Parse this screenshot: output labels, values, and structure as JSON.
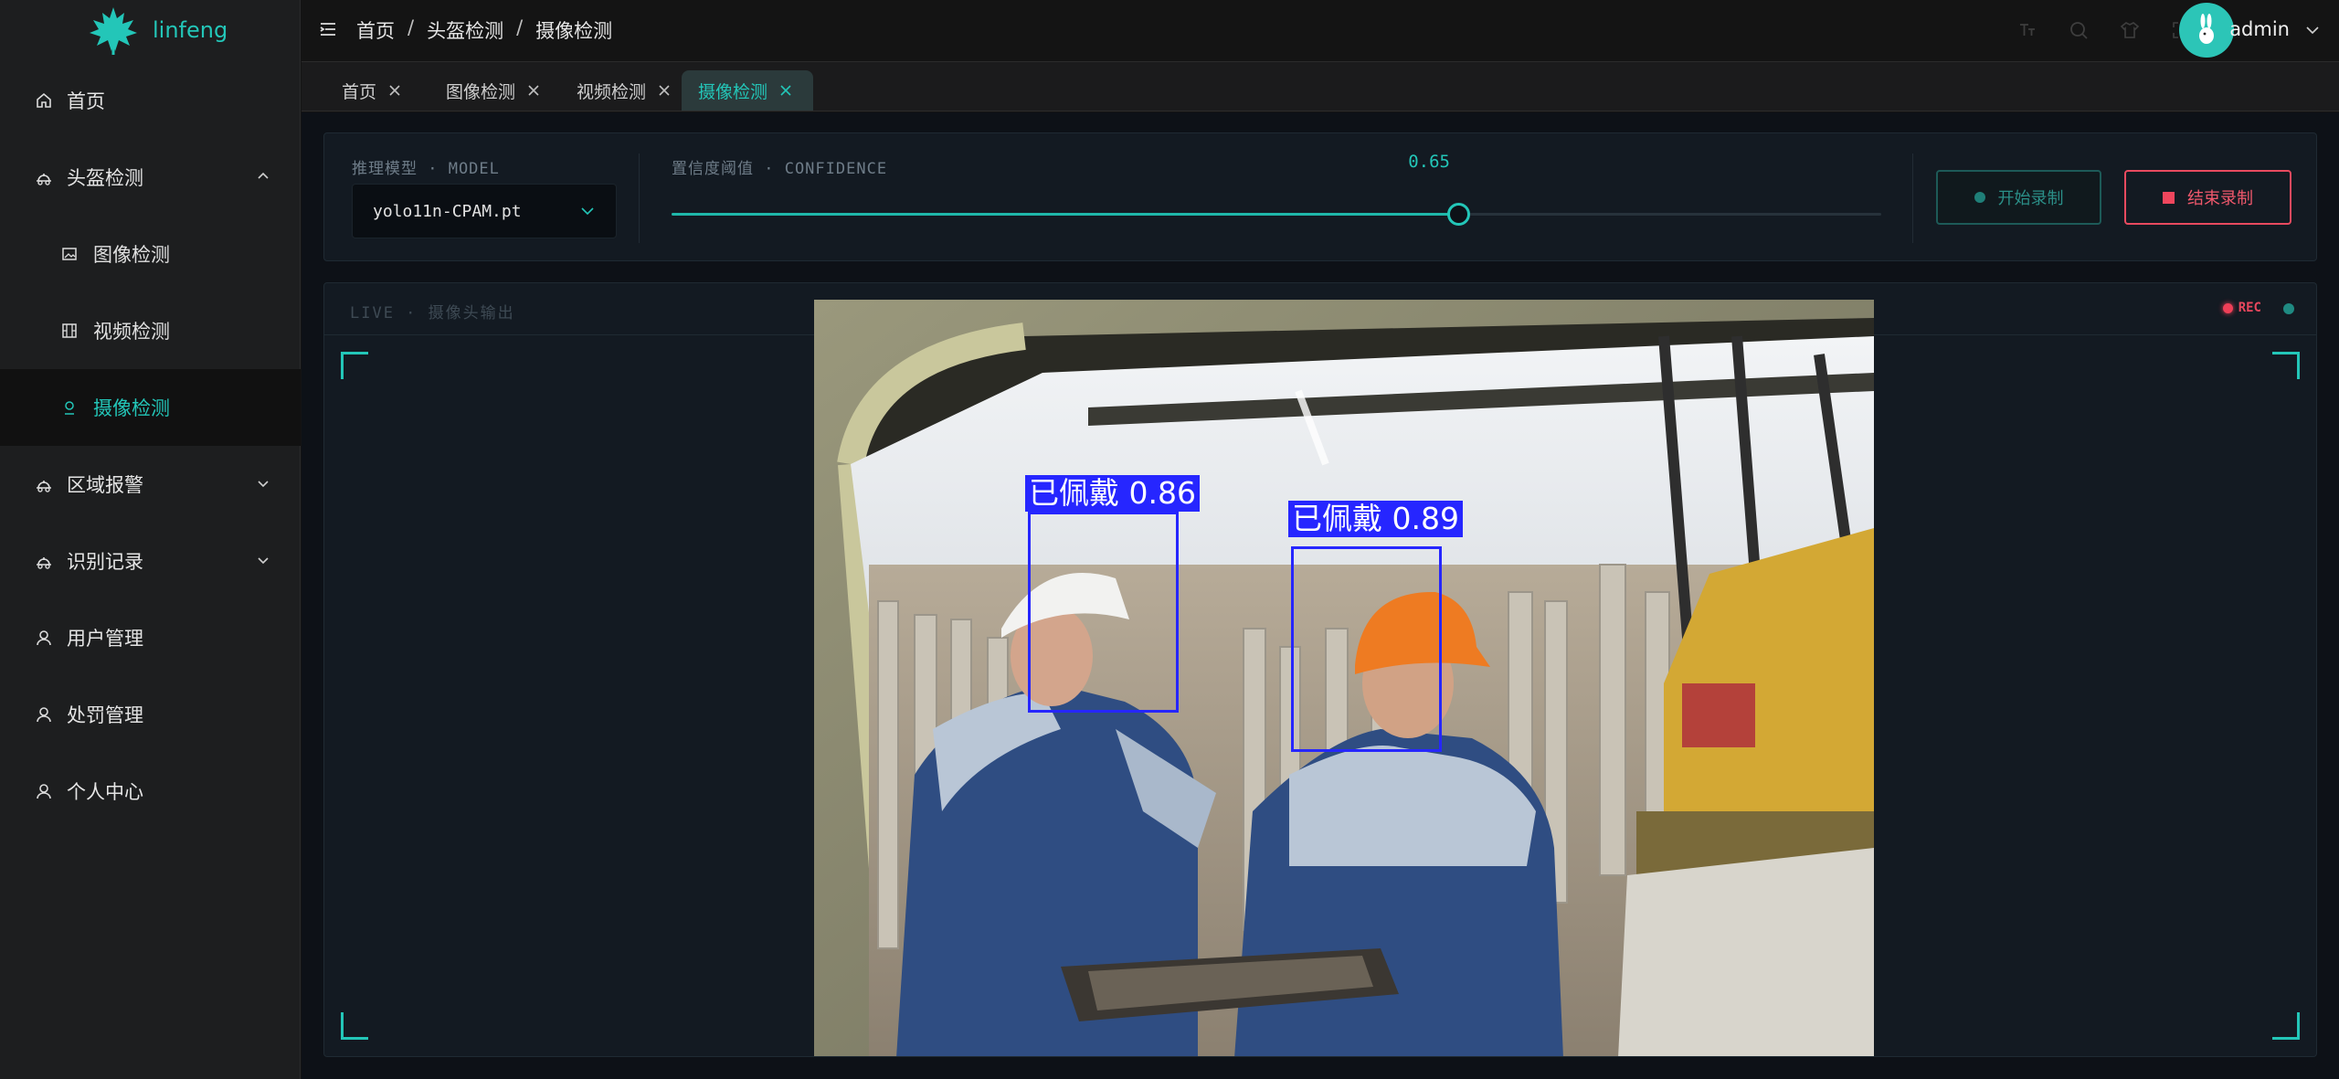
{
  "brand": {
    "name": "linfeng",
    "accent": "#23c6b8"
  },
  "sidebar": {
    "items": [
      {
        "label": "首页",
        "icon": "home-icon"
      },
      {
        "label": "头盔检测",
        "icon": "helmet-icon",
        "expanded": true,
        "children": [
          {
            "label": "图像检测",
            "icon": "image-icon"
          },
          {
            "label": "视频检测",
            "icon": "video-icon"
          },
          {
            "label": "摄像检测",
            "icon": "camera-icon",
            "active": true
          }
        ]
      },
      {
        "label": "区域报警",
        "icon": "helmet-icon",
        "expanded": false
      },
      {
        "label": "识别记录",
        "icon": "helmet-icon",
        "expanded": false
      },
      {
        "label": "用户管理",
        "icon": "user-icon"
      },
      {
        "label": "处罚管理",
        "icon": "user-icon"
      },
      {
        "label": "个人中心",
        "icon": "user-icon"
      }
    ]
  },
  "header": {
    "breadcrumb": [
      "首页",
      "头盔检测",
      "摄像检测"
    ],
    "separator": "/",
    "user": {
      "name": "admin"
    },
    "tools": [
      "font-size-icon",
      "search-icon",
      "theme-icon",
      "fullscreen-icon"
    ]
  },
  "tabs": [
    {
      "label": "首页",
      "active": false
    },
    {
      "label": "图像检测",
      "active": false
    },
    {
      "label": "视频检测",
      "active": false
    },
    {
      "label": "摄像检测",
      "active": true
    }
  ],
  "controls": {
    "model_label": "推理模型 · MODEL",
    "model_value": "yolo11n-CPAM.pt",
    "confidence_label": "置信度阈值 · CONFIDENCE",
    "confidence_value": "0.65",
    "confidence_fraction": 0.65,
    "start_label": "开始录制",
    "stop_label": "结束录制"
  },
  "live": {
    "label": "LIVE · 摄像头输出",
    "rec_label": "REC",
    "detections": [
      {
        "label": "已佩戴 0.86"
      },
      {
        "label": "已佩戴 0.89"
      }
    ]
  }
}
